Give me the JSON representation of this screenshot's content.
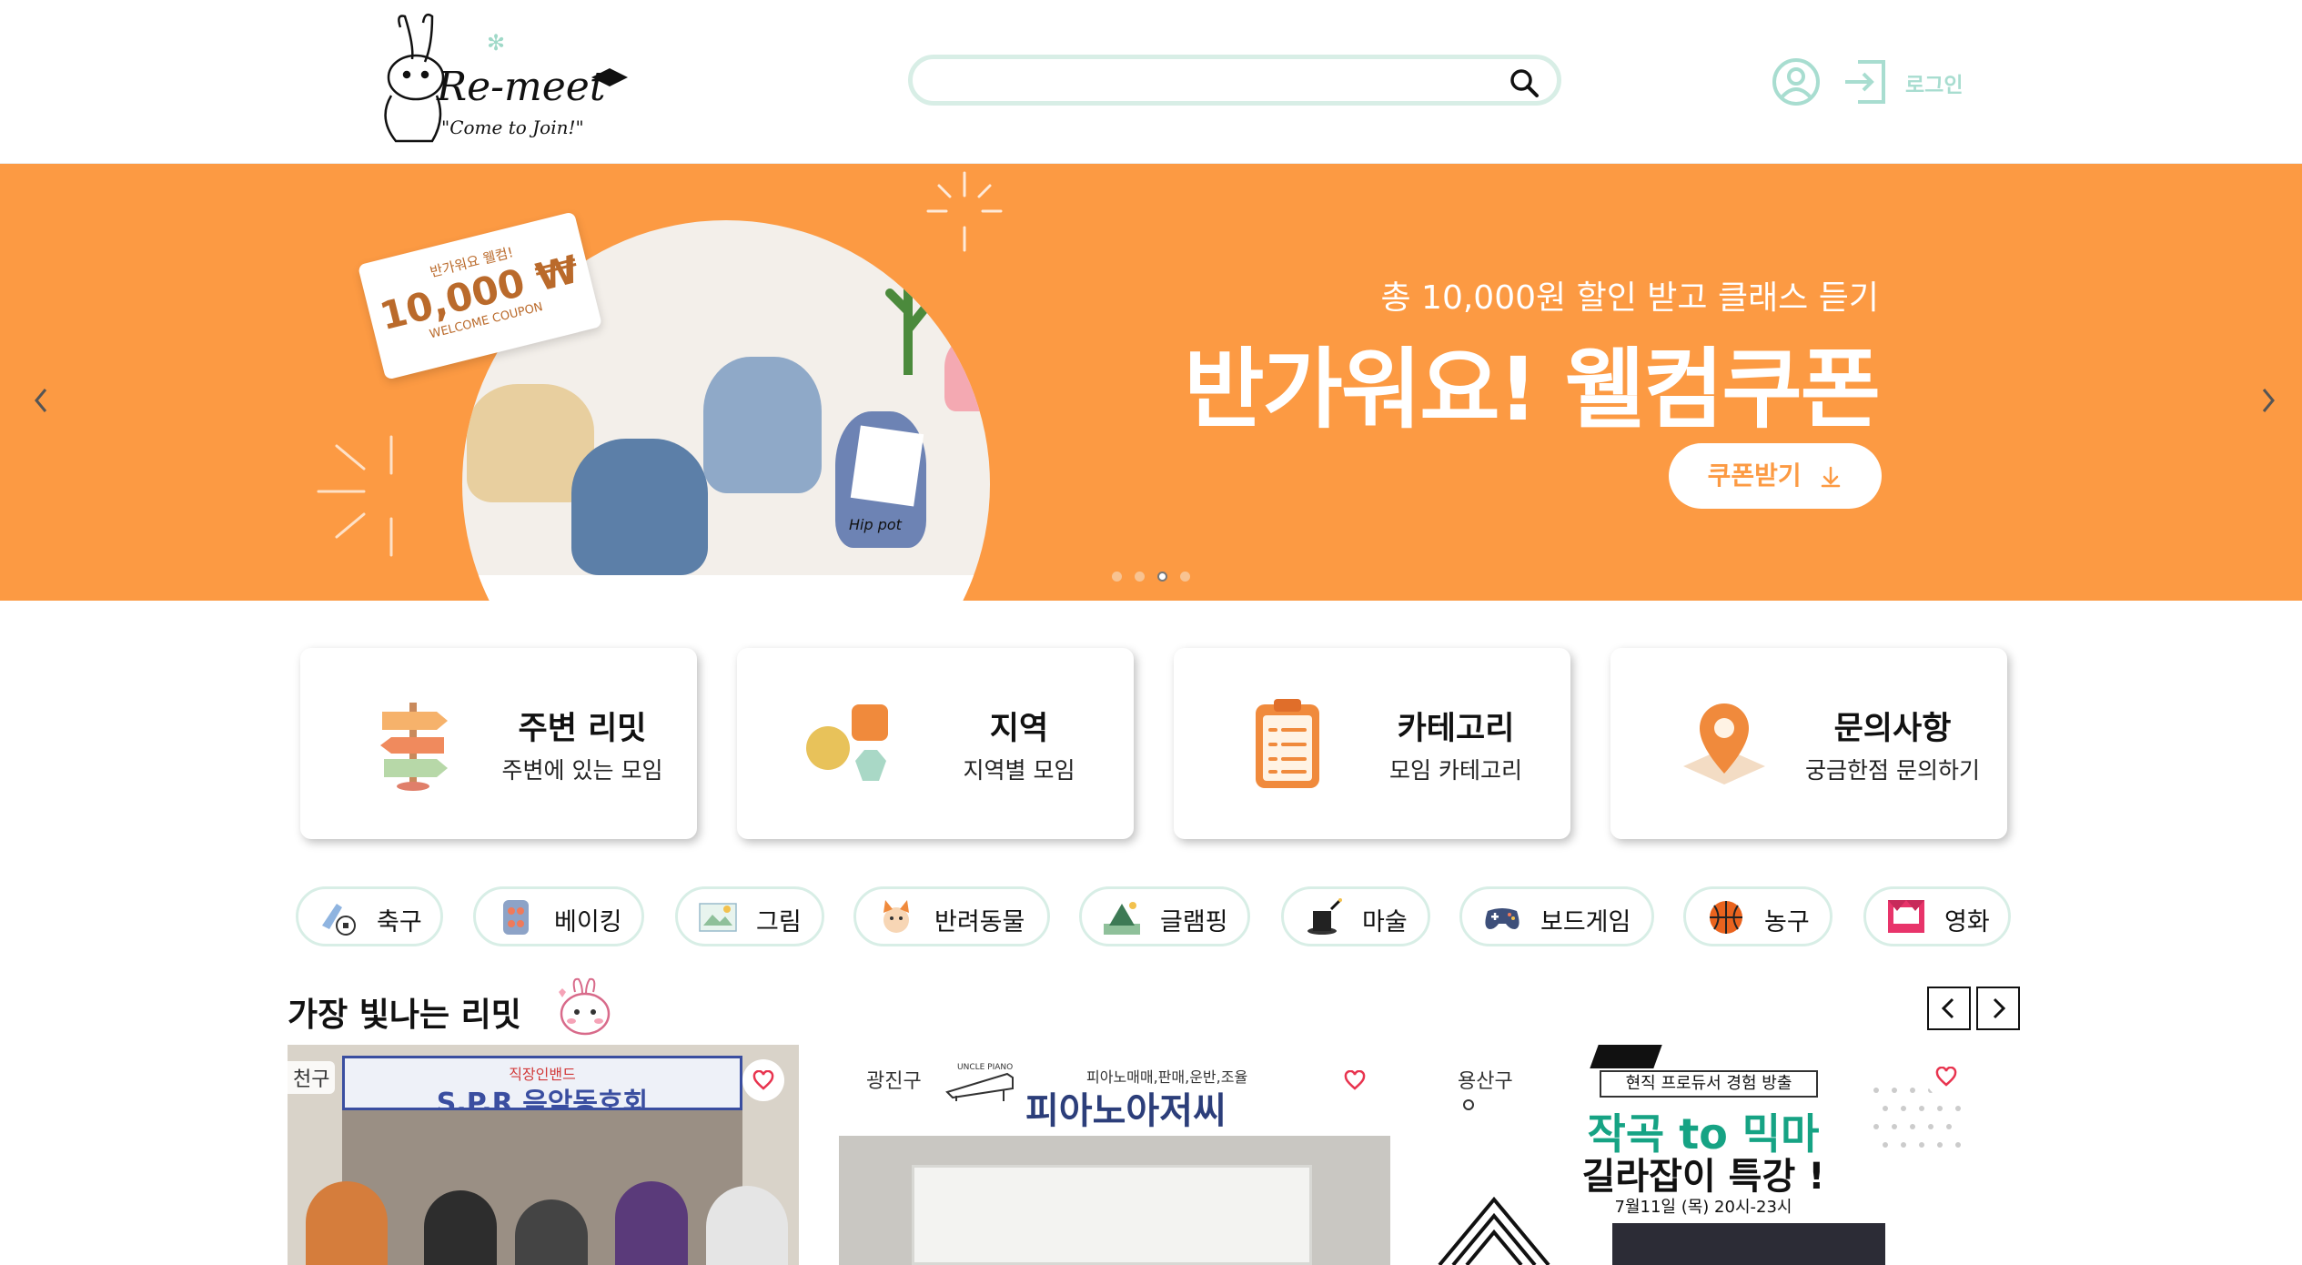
{
  "header": {
    "logo": {
      "wordmark": "Re-meet",
      "tagline": "\"Come to Join!\""
    },
    "search": {
      "placeholder": "",
      "value": ""
    },
    "login_label": "로그인"
  },
  "banner": {
    "subtitle": "총 10,000원 할인 받고 클래스 듣기",
    "headline": "반가워요! 웰컴쿠폰",
    "cta_label": "쿠폰받기",
    "coupon": {
      "line1": "반가워요 웰컴!",
      "amount": "10,000 ₩",
      "line3": "WELCOME COUPON"
    },
    "pot_label": "Hip pot",
    "slides": 4,
    "active_slide": 3,
    "background_color": "#fc9a43"
  },
  "quick_menu": [
    {
      "title": "주변 리밋",
      "subtitle": "주변에 있는 모임",
      "icon": "signpost-icon"
    },
    {
      "title": "지역",
      "subtitle": "지역별 모임",
      "icon": "shapes-icon"
    },
    {
      "title": "카테고리",
      "subtitle": "모임 카테고리",
      "icon": "clipboard-icon"
    },
    {
      "title": "문의사항",
      "subtitle": "궁금한점 문의하기",
      "icon": "location-pin-icon"
    }
  ],
  "categories": [
    {
      "label": "축구",
      "icon": "soccer-icon"
    },
    {
      "label": "베이킹",
      "icon": "baking-icon"
    },
    {
      "label": "그림",
      "icon": "drawing-icon"
    },
    {
      "label": "반려동물",
      "icon": "pet-icon"
    },
    {
      "label": "글램핑",
      "icon": "glamping-icon"
    },
    {
      "label": "마술",
      "icon": "magic-hat-icon"
    },
    {
      "label": "보드게임",
      "icon": "gamepad-icon"
    },
    {
      "label": "농구",
      "icon": "basketball-icon"
    },
    {
      "label": "영화",
      "icon": "cinema-icon"
    }
  ],
  "featured": {
    "title": "가장 빛나는 리밋",
    "items": [
      {
        "region": "천구",
        "banner_top": "직장인밴드",
        "banner_main": "S.P.R 음악동호회"
      },
      {
        "region": "광진구",
        "banner_top": "피아노매매,판매,운반,조율",
        "banner_main": "피아노아저씨",
        "brand": "UNCLE PIANO"
      },
      {
        "region": "용산구",
        "banner_top": "현직 프로듀서 경험 방출",
        "banner_main": "작곡 to 믹마",
        "banner_sub": "길라잡이 특강 !",
        "banner_date": "7월11일 (목) 20시-23시"
      }
    ]
  },
  "colors": {
    "accent_mint": "#d8eee6",
    "login_mint": "#a8ddd0",
    "banner_orange": "#fc9a43",
    "heart_red": "#e8344f"
  }
}
